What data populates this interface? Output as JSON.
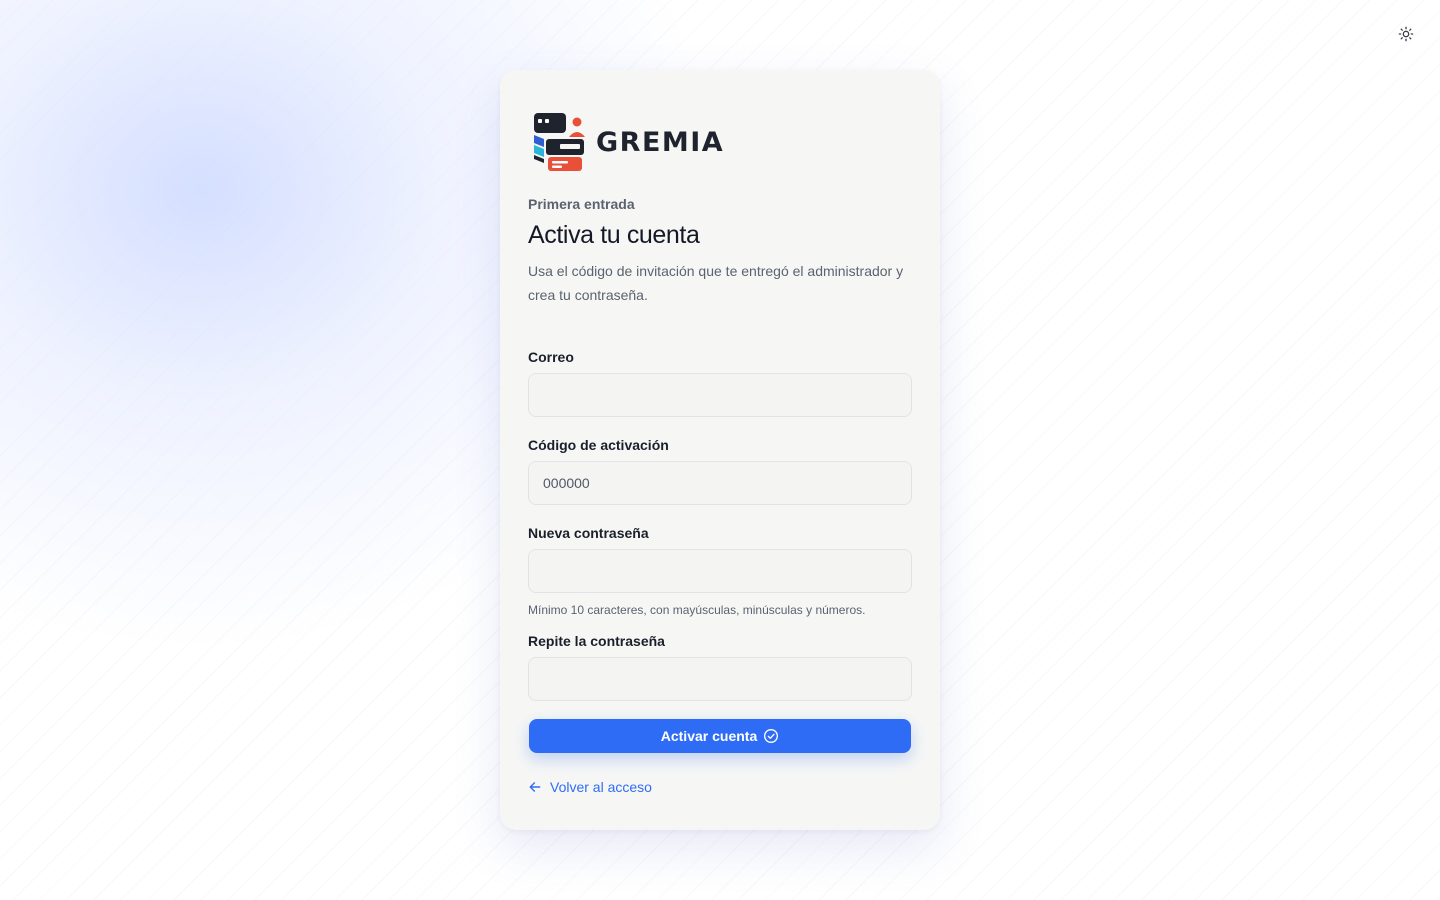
{
  "theme_toggle": {
    "icon": "sun-icon"
  },
  "brand": {
    "name": "GREMIA"
  },
  "header": {
    "eyebrow": "Primera entrada",
    "title": "Activa tu cuenta",
    "description": "Usa el código de invitación que te entregó el administrador y crea tu contraseña."
  },
  "form": {
    "email": {
      "label": "Correo",
      "value": "",
      "placeholder": ""
    },
    "code": {
      "label": "Código de activación",
      "value": "",
      "placeholder": "000000"
    },
    "password": {
      "label": "Nueva contraseña",
      "value": "",
      "placeholder": "",
      "hint": "Mínimo 10 caracteres, con mayúsculas, minúsculas y números."
    },
    "confirm": {
      "label": "Repite la contraseña",
      "value": "",
      "placeholder": ""
    },
    "submit_label": "Activar cuenta",
    "back_label": "Volver al acceso"
  },
  "colors": {
    "primary": "#2f6cf6",
    "card_bg": "#f6f7f5",
    "brand_red": "#e8503a",
    "brand_cyan": "#29b6d8",
    "brand_blue": "#2f5fd0",
    "brand_dark": "#1e232e"
  }
}
